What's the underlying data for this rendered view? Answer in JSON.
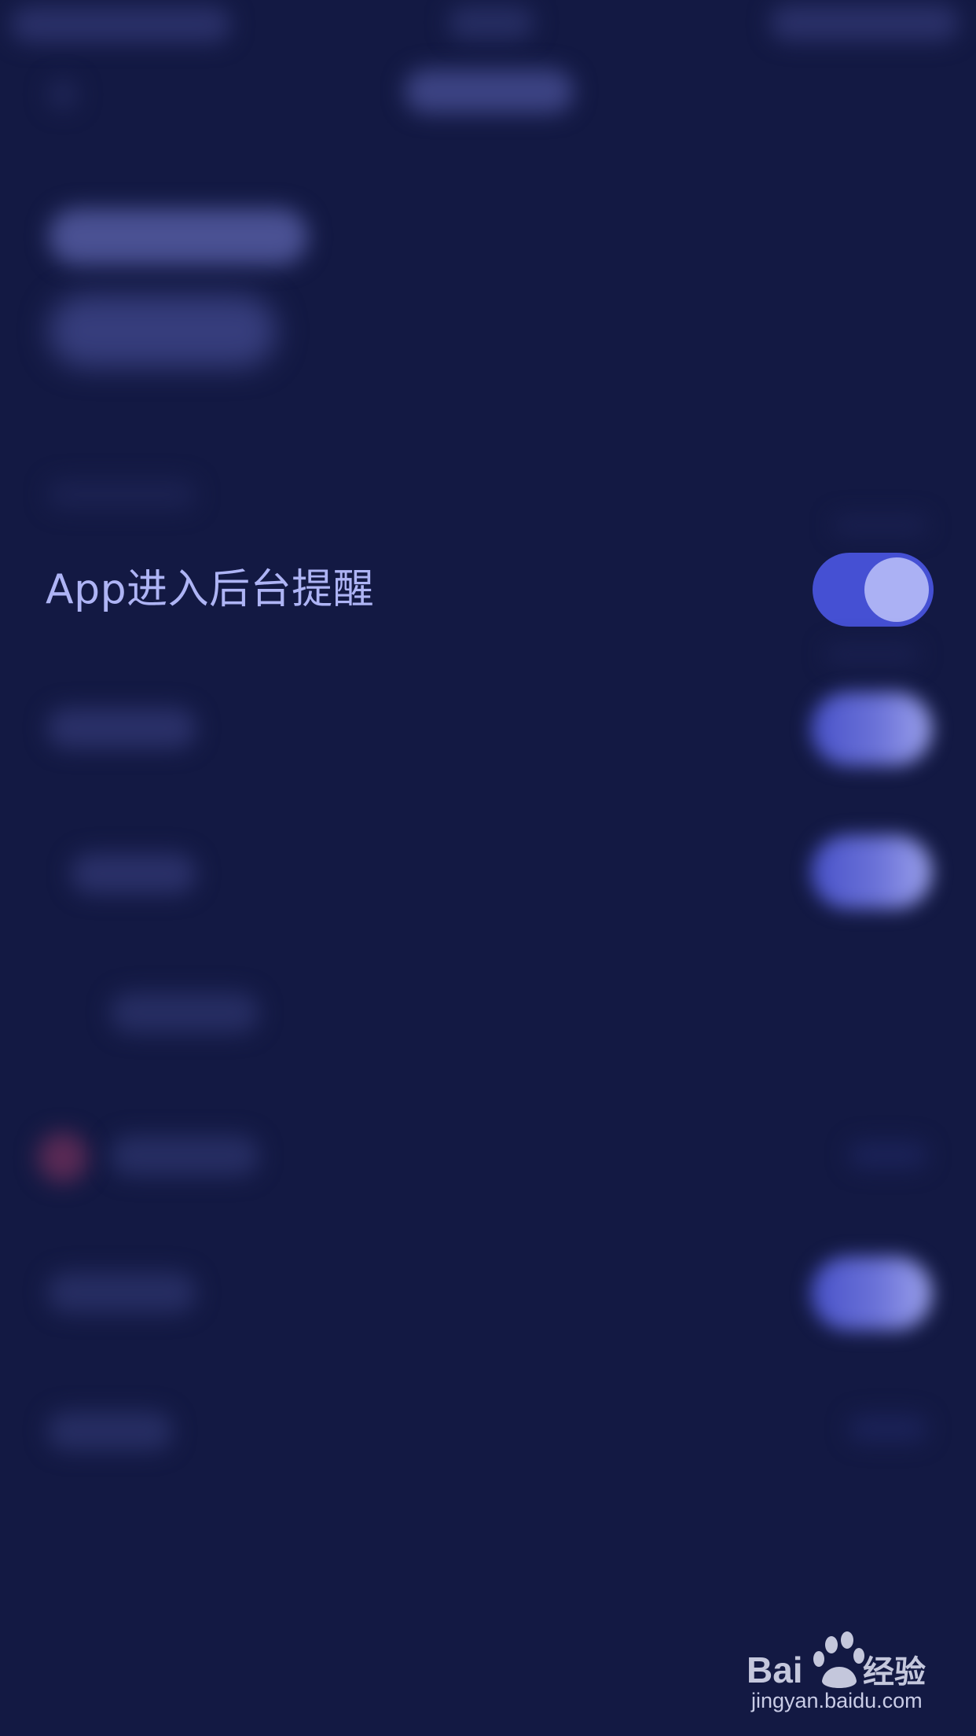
{
  "settings": {
    "app_background_reminder": {
      "label": "App进入后台提醒",
      "enabled": true
    }
  },
  "colors": {
    "background": "#131943",
    "label": "#aeb4f5",
    "toggle_on": "#4550d3",
    "toggle_knob": "#abb1f4"
  },
  "watermark": {
    "logo_text": "Bai du 经验",
    "url": "jingyan.baidu.com"
  }
}
